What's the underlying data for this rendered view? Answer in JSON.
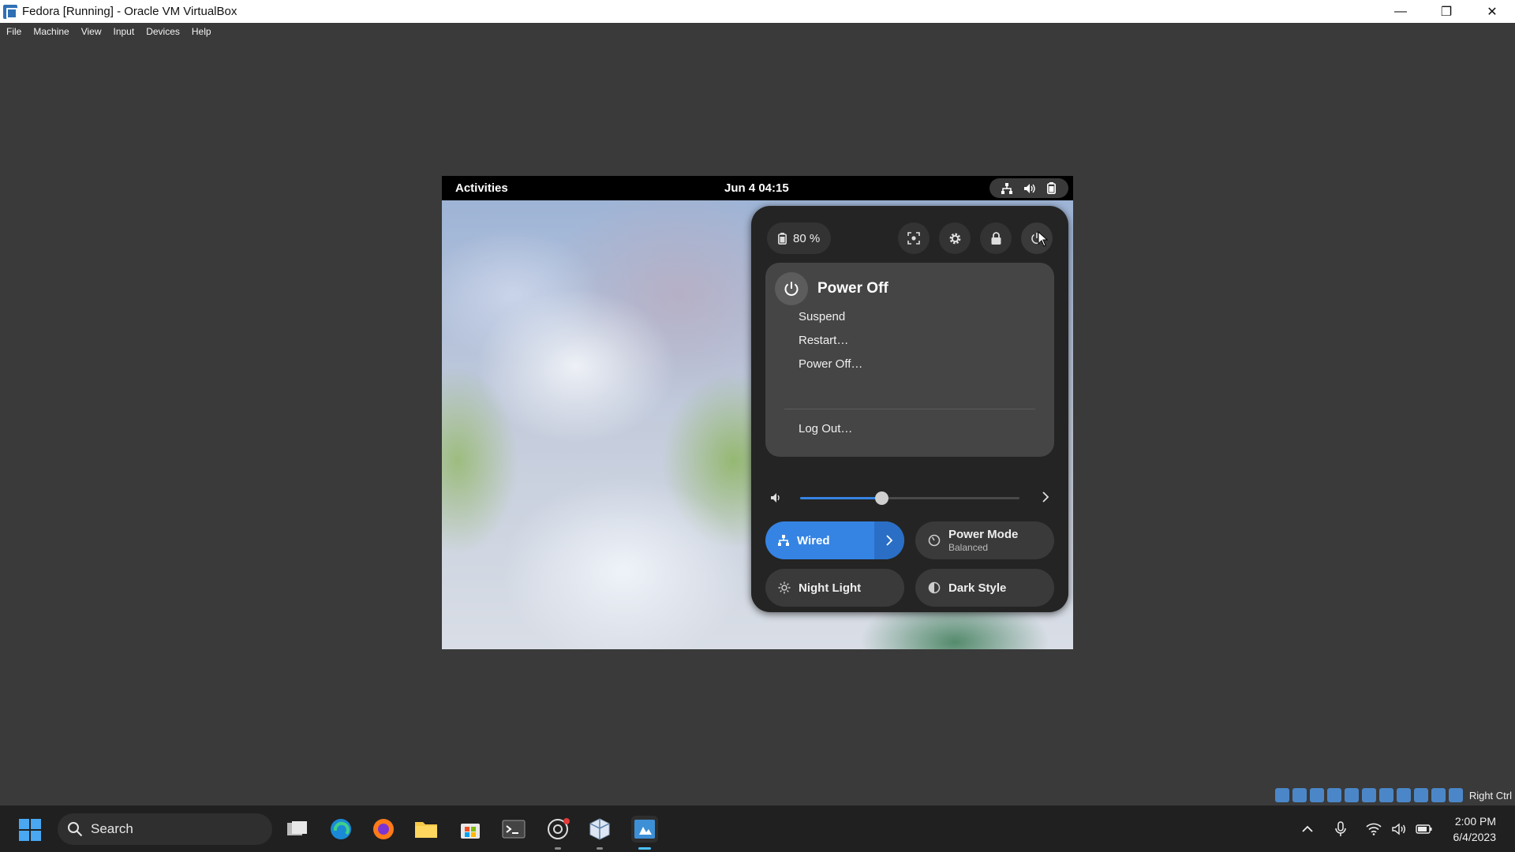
{
  "window": {
    "title": "Fedora [Running] - Oracle VM VirtualBox",
    "controls": [
      "—",
      "❐",
      "✕"
    ]
  },
  "menubar": {
    "items": [
      "File",
      "Machine",
      "View",
      "Input",
      "Devices",
      "Help"
    ]
  },
  "gnome": {
    "activities": "Activities",
    "clock": "Jun 4  04:15",
    "indicators": [
      "network-wired-icon",
      "volume-icon",
      "battery-icon"
    ]
  },
  "quick_settings": {
    "battery": {
      "label": "80 %",
      "level_percent": 80
    },
    "top_buttons": [
      "screenshot-icon",
      "settings-icon",
      "lock-icon",
      "power-icon"
    ],
    "power_menu": {
      "title": "Power Off",
      "items": [
        "Suspend",
        "Restart…",
        "Power Off…"
      ],
      "logout": "Log Out…"
    },
    "volume": {
      "level_percent": 37
    },
    "tiles": {
      "wired": {
        "label": "Wired"
      },
      "power_mode": {
        "label": "Power Mode",
        "sub": "Balanced"
      },
      "night_light": {
        "label": "Night Light"
      },
      "dark_style": {
        "label": "Dark Style"
      }
    }
  },
  "vbox_status": {
    "host_key": "Right Ctrl"
  },
  "taskbar": {
    "search": "Search",
    "clock_time": "2:00 PM",
    "clock_date": "6/4/2023"
  },
  "colors": {
    "accent": "#3584e4",
    "panel": "#242424",
    "taskbar": "#202020"
  }
}
